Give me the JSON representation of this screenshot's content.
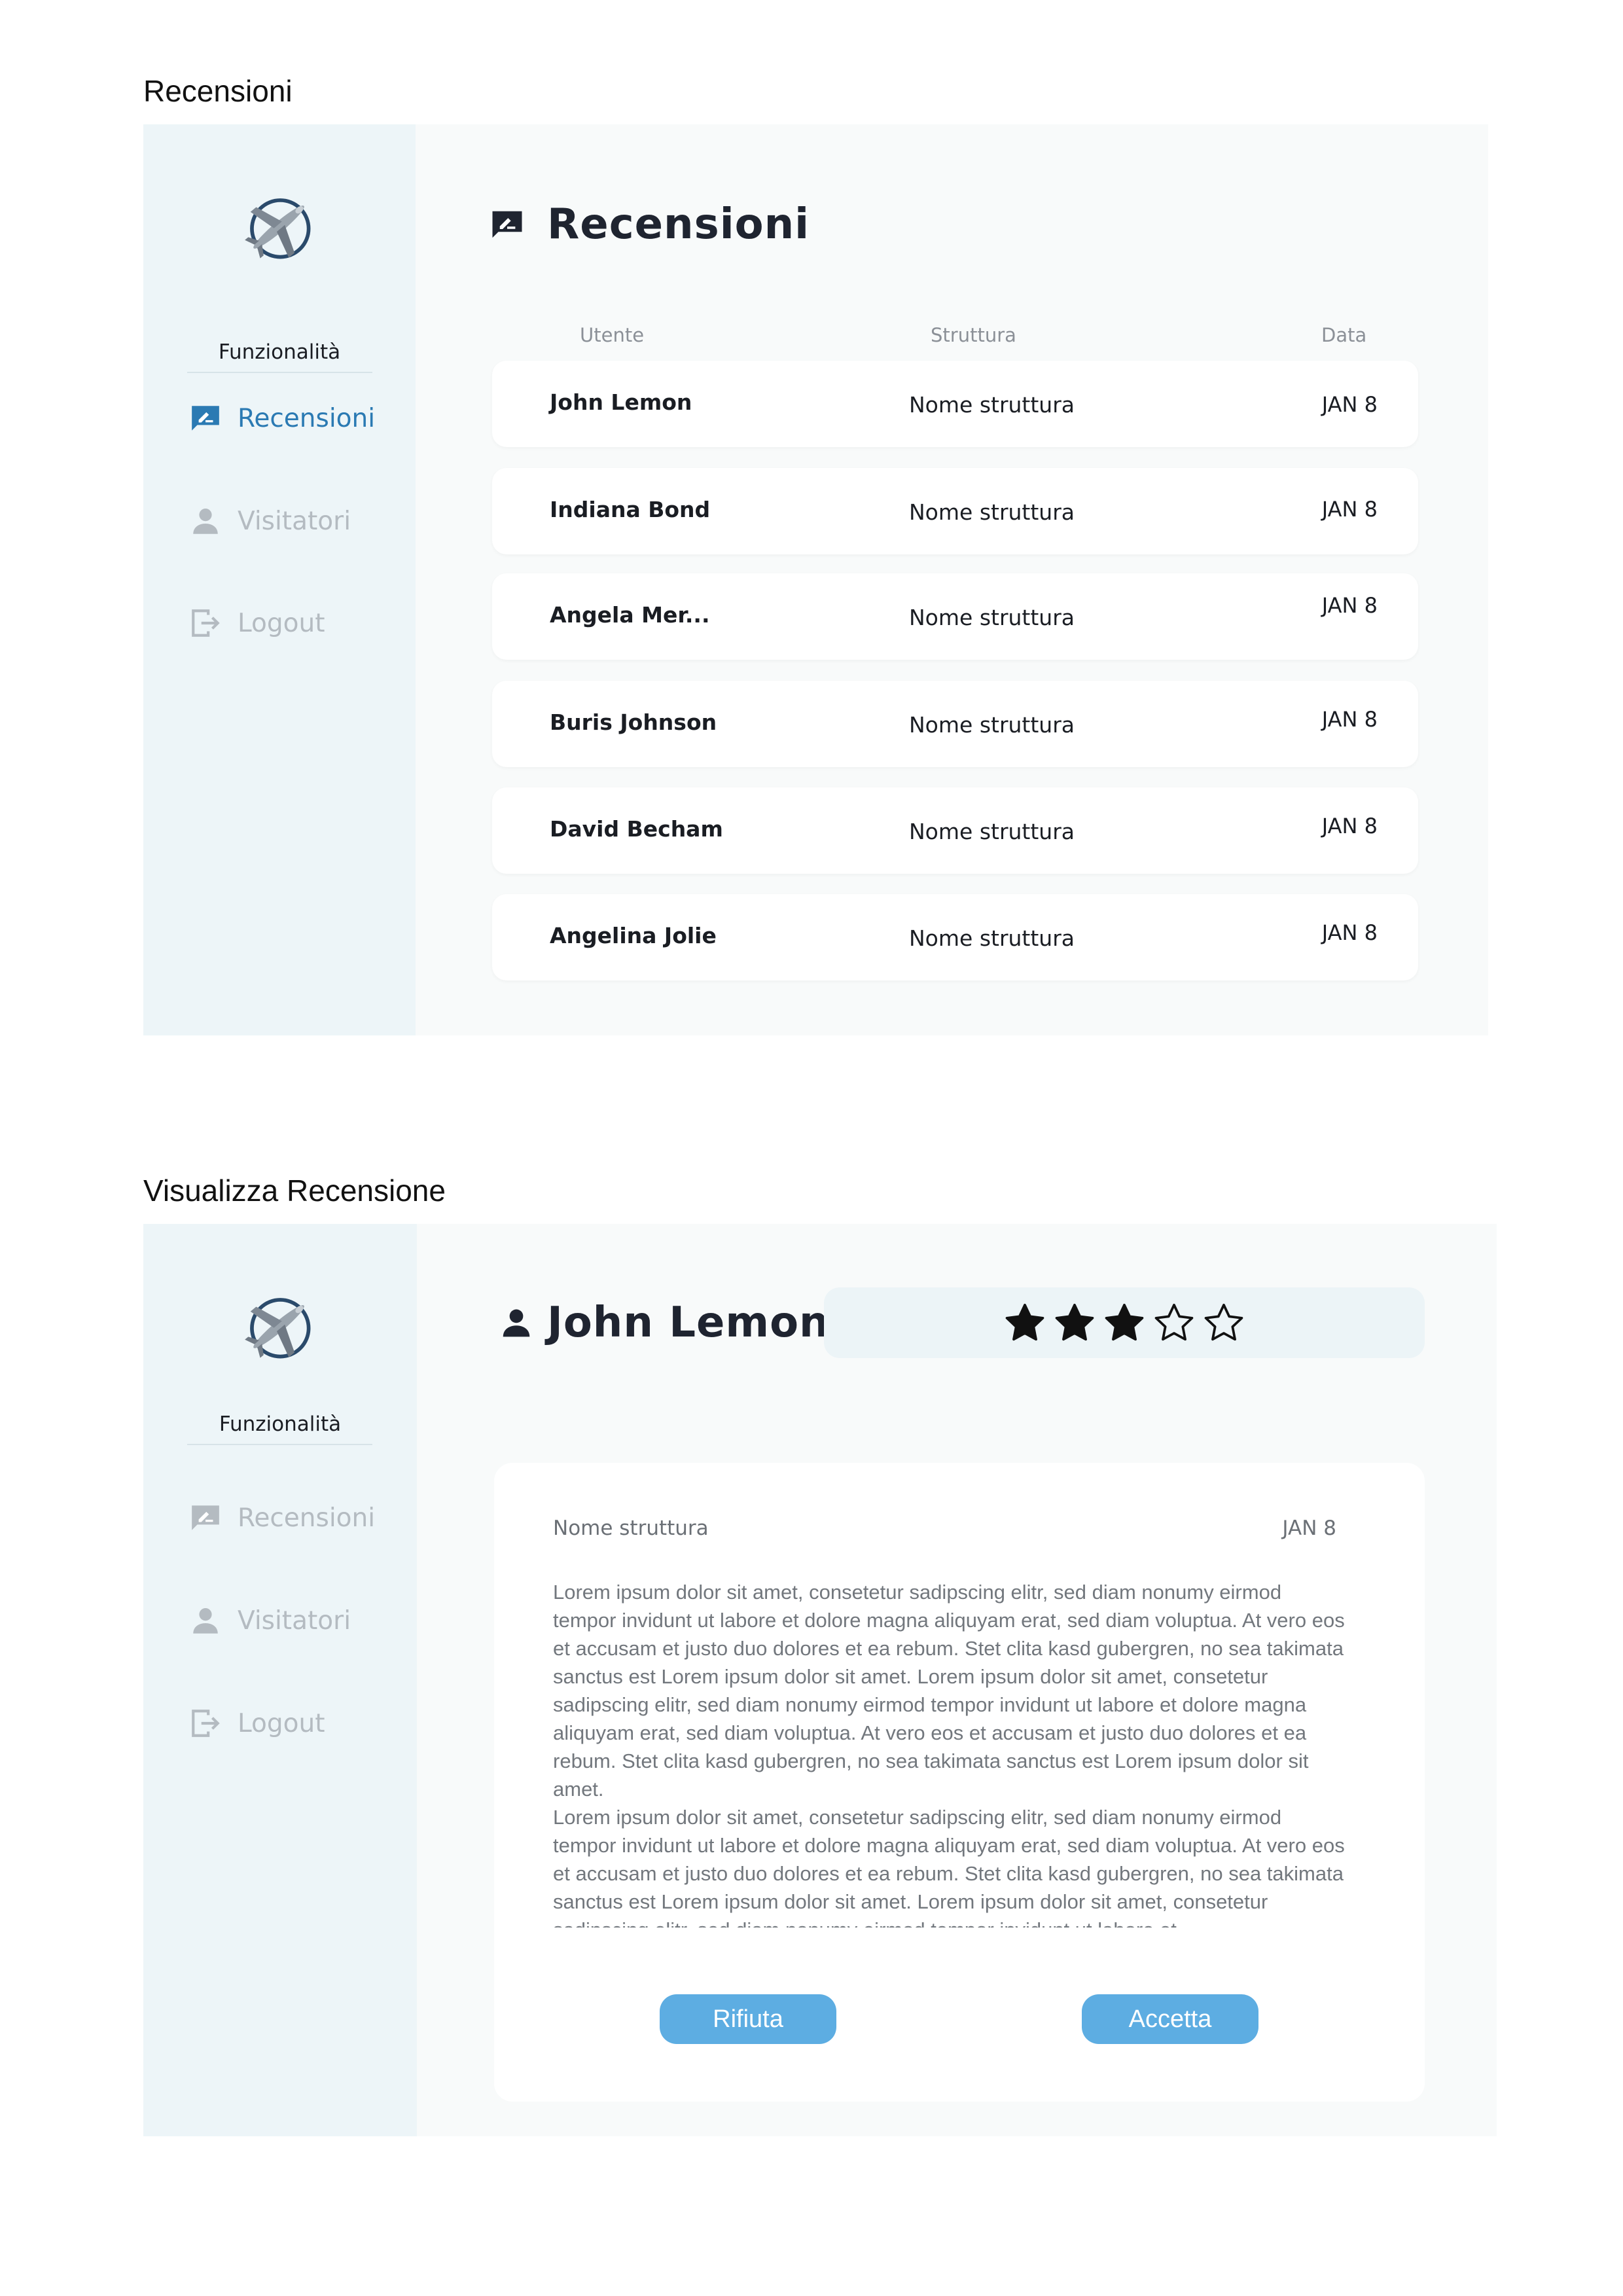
{
  "screens": {
    "list": {
      "section_label": "Recensioni",
      "title": "Recensioni",
      "columns": {
        "user": "Utente",
        "structure": "Struttura",
        "date": "Data"
      },
      "rows": [
        {
          "user": "John Lemon",
          "structure": "Nome struttura",
          "date": "JAN 8"
        },
        {
          "user": "Indiana Bond",
          "structure": "Nome struttura",
          "date": "JAN 8"
        },
        {
          "user": "Angela Mer...",
          "structure": "Nome struttura",
          "date": "JAN 8"
        },
        {
          "user": "Buris Johnson",
          "structure": "Nome struttura",
          "date": "JAN 8"
        },
        {
          "user": "David Becham",
          "structure": "Nome struttura",
          "date": "JAN 8"
        },
        {
          "user": "Angelina Jolie",
          "structure": "Nome struttura",
          "date": "JAN 8"
        }
      ]
    },
    "detail": {
      "section_label": "Visualizza Recensione",
      "user": "John Lemon",
      "rating": 3,
      "rating_max": 5,
      "structure": "Nome struttura",
      "date": "JAN 8",
      "paragraphs": [
        "Lorem ipsum dolor sit amet, consetetur sadipscing elitr, sed diam nonumy eirmod tempor invidunt ut labore et dolore magna aliquyam erat, sed diam voluptua. At vero eos et accusam et justo duo dolores et ea rebum. Stet clita kasd gubergren, no sea takimata sanctus est Lorem ipsum dolor sit amet. Lorem ipsum dolor sit amet, consetetur sadipscing elitr, sed diam nonumy eirmod tempor invidunt ut labore et dolore magna aliquyam erat, sed diam voluptua. At vero eos et accusam et justo duo dolores et ea rebum. Stet clita kasd gubergren, no sea takimata sanctus est Lorem ipsum dolor sit amet.",
        "Lorem ipsum dolor sit amet, consetetur sadipscing elitr, sed diam nonumy eirmod tempor invidunt ut labore et dolore magna aliquyam erat, sed diam voluptua. At vero eos et accusam et justo duo dolores et ea rebum. Stet clita kasd gubergren, no sea takimata sanctus est Lorem ipsum dolor sit amet. Lorem ipsum dolor sit amet, consetetur sadipscing elitr, sed diam nonumy eirmod tempor invidunt ut labore et"
      ],
      "buttons": {
        "reject": "Rifiuta",
        "accept": "Accetta"
      }
    }
  },
  "sidebar": {
    "heading": "Funzionalità",
    "items": [
      {
        "label": "Recensioni",
        "icon": "review-edit-icon"
      },
      {
        "label": "Visitatori",
        "icon": "person-icon"
      },
      {
        "label": "Logout",
        "icon": "logout-icon"
      }
    ]
  },
  "colors": {
    "accent": "#2b7ab3",
    "sidebar_bg": "#edf5f8",
    "main_bg": "#f8fafa",
    "button_bg": "#5dade2",
    "inactive_nav": "#b4bbc1"
  }
}
